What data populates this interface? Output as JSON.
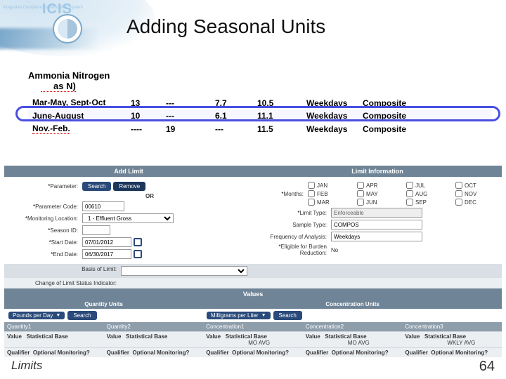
{
  "header": {
    "system_abbrev": "ICIS",
    "system_sub": "Integrated Compliance Information System"
  },
  "title": "Adding Seasonal Units",
  "parameter_name_line1": "Ammonia Nitrogen",
  "parameter_name_line2": "as N)",
  "table": {
    "rows": [
      {
        "season": "Mar-May, Sept-Oct",
        "q1": "13",
        "q2": "---",
        "c1": "7.7",
        "c2": "10.5",
        "freq": "Weekdays",
        "samp": "Composite"
      },
      {
        "season": "June-August",
        "q1": "10",
        "q2": "---",
        "c1": "6.1",
        "c2": "11.1",
        "freq": "Weekdays",
        "samp": "Composite"
      },
      {
        "season": "Nov.-Feb.",
        "q1": "----",
        "q2": "19",
        "c1": "---",
        "c2": "11.5",
        "freq": "Weekdays",
        "samp": "Composite"
      }
    ]
  },
  "form": {
    "section_add": "Add Limit",
    "section_info": "Limit Information",
    "labels": {
      "parameter": "Parameter:",
      "or": "OR",
      "parameter_code": "Parameter Code:",
      "monitoring_location": "Monitoring Location:",
      "season_id": "Season ID:",
      "start_date": "Start Date:",
      "end_date": "End Date:",
      "basis_of_limit": "Basis of Limit:",
      "change_indicator": "Change of Limit Status Indicator:",
      "months": "Months:",
      "limit_type": "Limit Type:",
      "sample_type": "Sample Type:",
      "freq_analysis": "Frequency of Analysis:",
      "eligible": "Eligible for Burden Reduction:"
    },
    "buttons": {
      "search": "Search",
      "remove": "Remove"
    },
    "values": {
      "parameter_code": "00610",
      "monitoring_location": "1 - Effluent Gross",
      "season_id": "",
      "start_date": "07/01/2012",
      "end_date": "06/30/2017",
      "limit_type": "Enforceable",
      "sample_type": "COMPOS",
      "freq_analysis": "Weekdays",
      "eligible": "No"
    },
    "months": [
      "JAN",
      "APR",
      "JUL",
      "OCT",
      "FEB",
      "MAY",
      "AUG",
      "NOV",
      "MAR",
      "JUN",
      "SEP",
      "DEC"
    ]
  },
  "values_section": {
    "header": "Values",
    "quantity_units": "Quantity Units",
    "concentration_units": "Concentration Units",
    "quantity_sel": "Pounds per Day",
    "concentration_sel": "Milligrams per Liter",
    "search": "Search",
    "subheaders": [
      "Quantity1",
      "Quantity2",
      "Concentration1",
      "Concentration2",
      "Concentration3"
    ],
    "row1": {
      "value": "Value",
      "stat": "Statistical Base"
    },
    "row2": {
      "qual": "Qualifier",
      "opt": "Optional Monitoring?"
    },
    "stat_values": {
      "c1": "MO AVG",
      "c2": "MO AVG",
      "c3": "WKLY AVG"
    }
  },
  "footer": {
    "section": "Limits",
    "page": "64"
  }
}
